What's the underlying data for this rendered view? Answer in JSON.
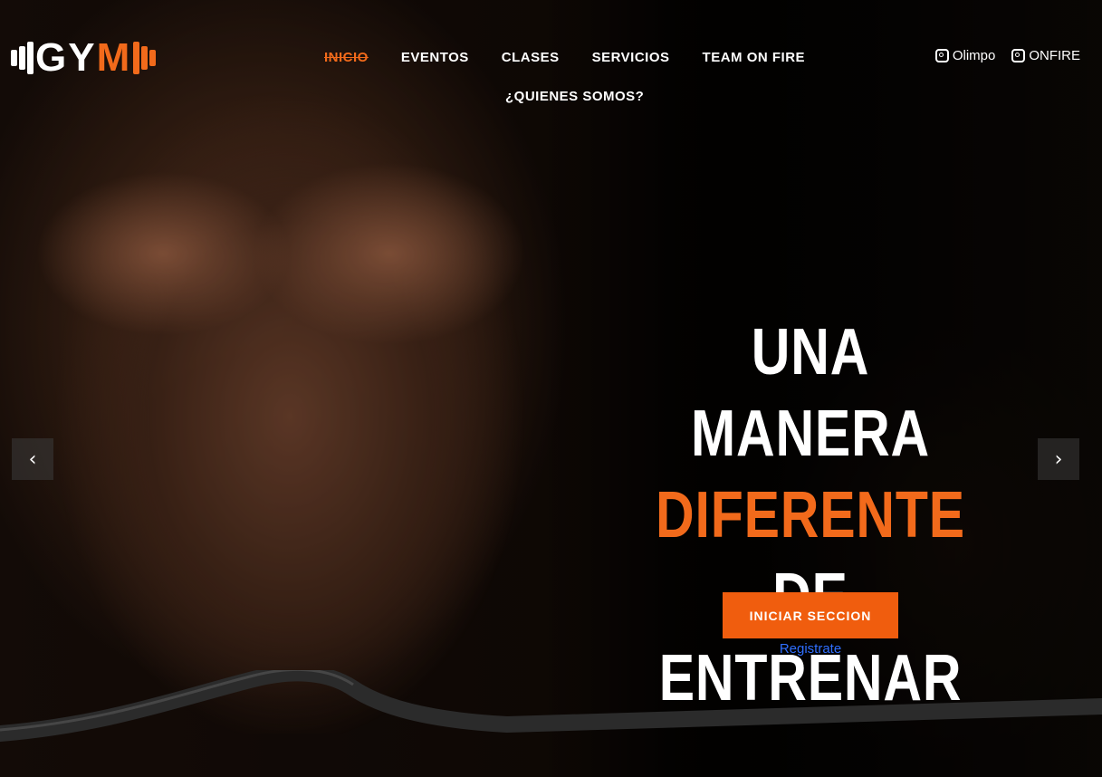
{
  "logo": {
    "text_white": "GY",
    "text_accent": "M",
    "icon": "dumbbell-icon"
  },
  "nav": {
    "items": [
      {
        "label": "INICIO",
        "active": true
      },
      {
        "label": "EVENTOS",
        "active": false
      },
      {
        "label": "CLASES",
        "active": false
      },
      {
        "label": "SERVICIOS",
        "active": false
      },
      {
        "label": "TEAM ON FIRE",
        "active": false
      },
      {
        "label": "¿QUIENES SOMOS?",
        "active": false
      }
    ]
  },
  "social": [
    {
      "label": "Olimpo",
      "icon": "instagram-icon"
    },
    {
      "label": "ONFIRE",
      "icon": "instagram-icon"
    }
  ],
  "hero": {
    "line1": "UNA MANERA",
    "line2_accent": "DIFERENTE",
    "line2_rest": "DE",
    "line3": "ENTRENAR",
    "cta_label": "INICIAR SECCION",
    "register_label": "Registrate"
  },
  "carousel": {
    "prev_icon": "chevron-left-icon",
    "next_icon": "chevron-right-icon",
    "prev_glyph": "‹",
    "next_glyph": "›"
  },
  "colors": {
    "accent": "#f26a1b",
    "cta_bg": "#f05d0e",
    "link": "#2f6fff",
    "text": "#ffffff"
  }
}
